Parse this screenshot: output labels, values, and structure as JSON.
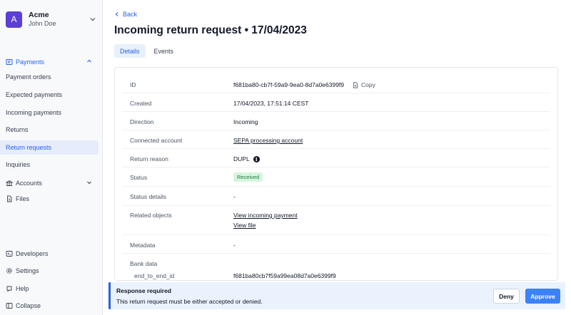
{
  "org": {
    "initial": "A",
    "name": "Acme",
    "user": "John Doe"
  },
  "nav": {
    "payments": "Payments",
    "payment_orders": "Payment orders",
    "expected_payments": "Expected payments",
    "incoming_payments": "Incoming payments",
    "returns": "Returns",
    "return_requests": "Return requests",
    "inquiries": "Inquiries",
    "accounts": "Accounts",
    "files": "Files",
    "developers": "Developers",
    "settings": "Settings",
    "help": "Help",
    "collapse": "Collapse"
  },
  "back_label": "Back",
  "page_title": "Incoming return request • 17/04/2023",
  "tabs": [
    {
      "label": "Details",
      "active": true
    },
    {
      "label": "Events",
      "active": false
    }
  ],
  "details": {
    "id": {
      "label": "ID",
      "value": "f681ba80-cb7f-59a9-9ea0-8d7a0e6399f9",
      "copy_label": "Copy"
    },
    "created": {
      "label": "Created",
      "value": "17/04/2023, 17:51:14 CEST"
    },
    "direction": {
      "label": "Direction",
      "value": "Incoming"
    },
    "connected_account": {
      "label": "Connected account",
      "value": "SEPA processing account"
    },
    "return_reason": {
      "label": "Return reason",
      "value": "DUPL"
    },
    "status": {
      "label": "Status",
      "value": "Received",
      "color": "#d6f5de"
    },
    "status_details": {
      "label": "Status details",
      "value": "-"
    },
    "related_objects": {
      "label": "Related objects",
      "links": [
        "View incoming payment",
        "View file"
      ]
    },
    "metadata": {
      "label": "Metadata",
      "value": "-"
    },
    "bank_data": {
      "label": "Bank data",
      "sub_label": "end_to_end_id",
      "sub_value": "f681ba80cb7f59a99ea08d7a0e6399f9"
    }
  },
  "banner": {
    "title": "Response required",
    "text": "This return request must be either accepted or denied.",
    "deny_label": "Deny",
    "approve_label": "Approve",
    "accent": "#2563eb"
  }
}
